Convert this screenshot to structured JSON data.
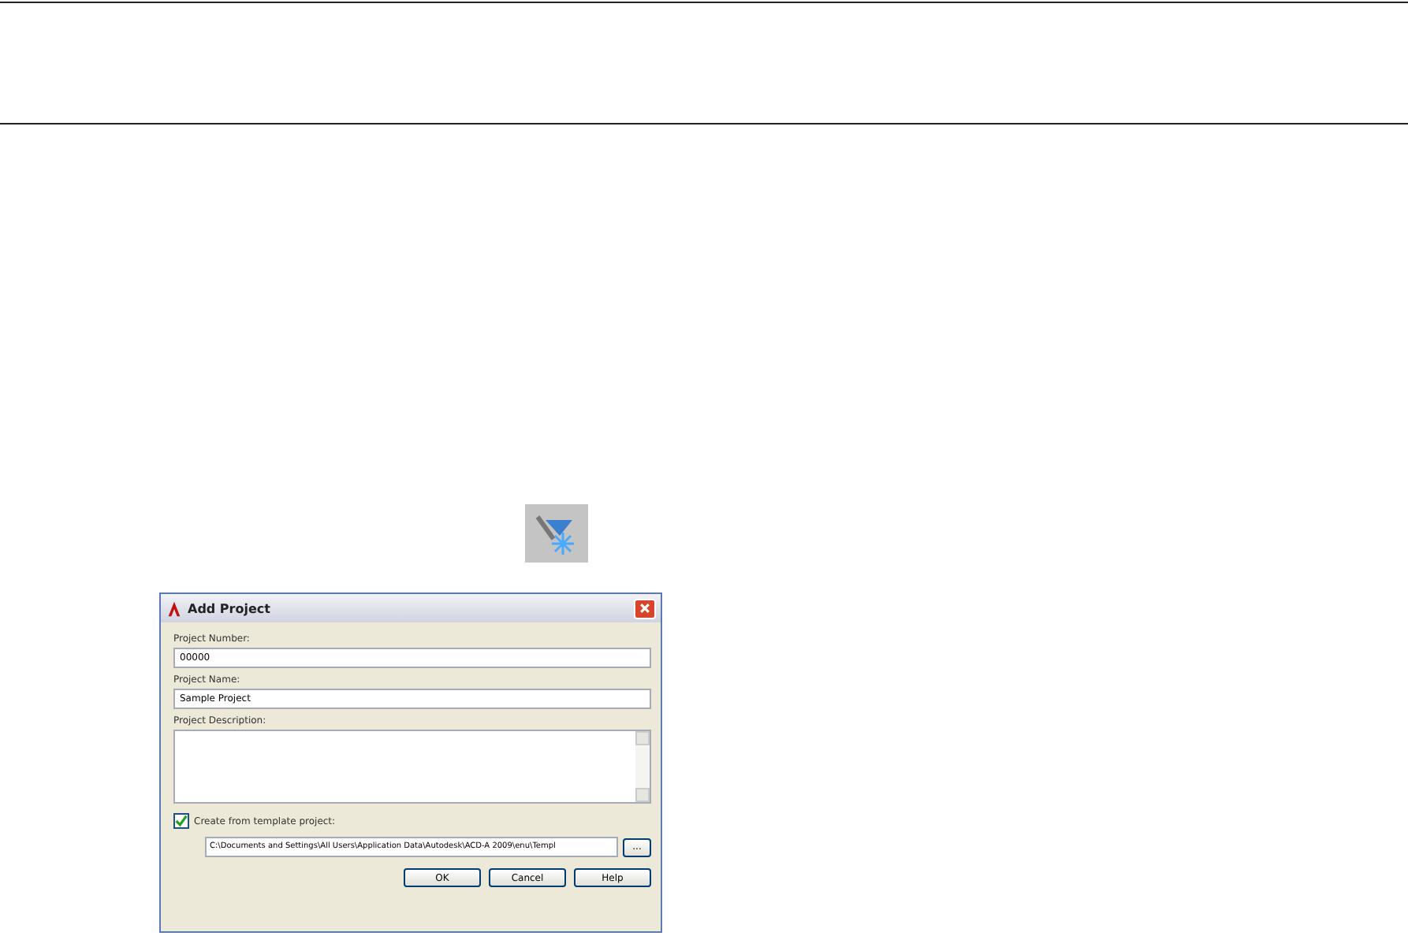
{
  "dialog": {
    "title": "Add Project",
    "fields": [
      {
        "label": "Project Number:",
        "value": "00000"
      },
      {
        "label": "Project Name:",
        "value": "Sample Project"
      }
    ],
    "description": {
      "label": "Project Description:"
    },
    "template": {
      "label": "Create from template project:",
      "checked": true,
      "path": "C:\\Documents and Settings\\All Users\\Application Data\\Autodesk\\ACD-A 2009\\enu\\Templ",
      "browse": "..."
    },
    "buttons": [
      "OK",
      "Cancel",
      "Help"
    ]
  }
}
